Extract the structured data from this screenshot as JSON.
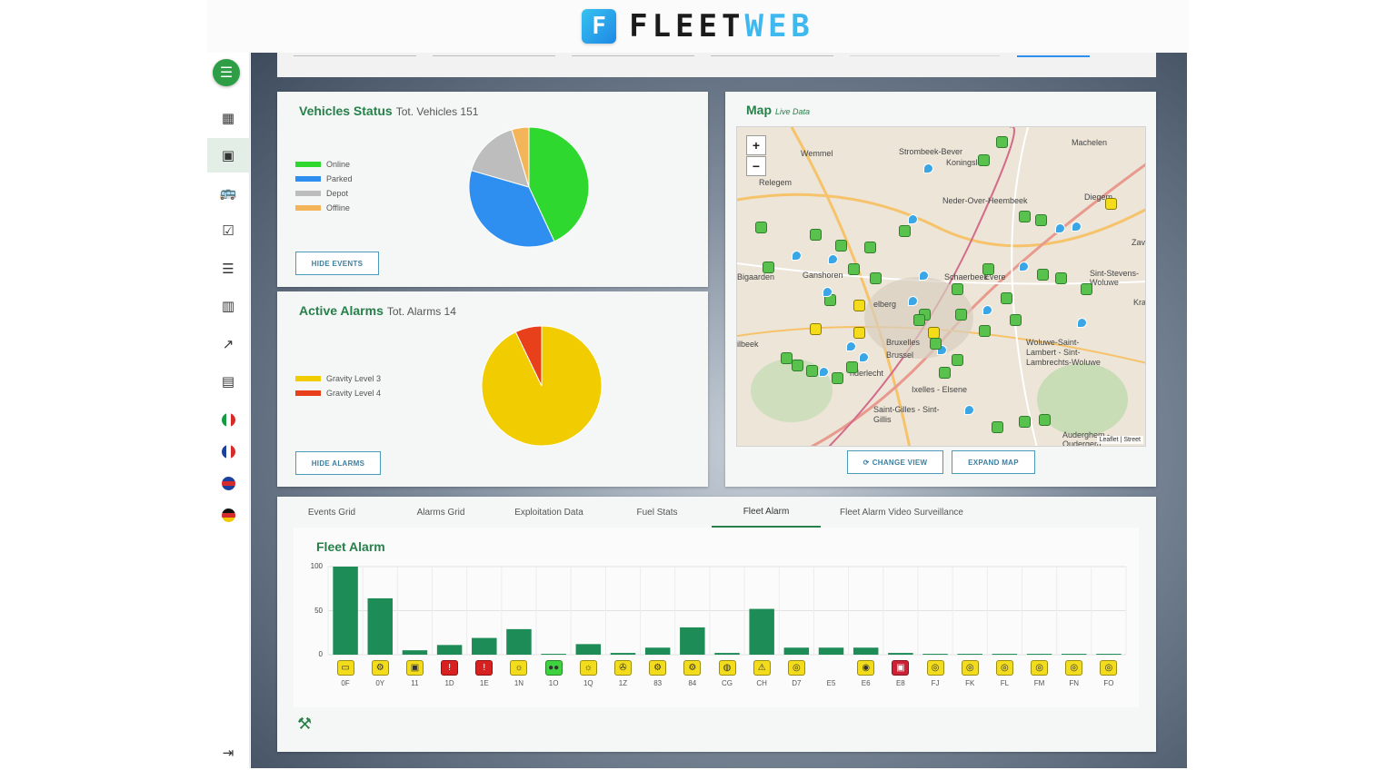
{
  "header": {
    "logo_fleet": "FLEET",
    "logo_web": "WEB",
    "logo_mark": "F"
  },
  "sidebar": {
    "items": [
      {
        "name": "sidebar-item-dashboard",
        "icon": "dashboard-icon",
        "glyph": "▦"
      },
      {
        "name": "sidebar-item-overview",
        "icon": "overview-dashboard-icon",
        "glyph": "▣",
        "active": true
      },
      {
        "name": "sidebar-item-vehicles",
        "icon": "bus-icon",
        "glyph": "🚌"
      },
      {
        "name": "sidebar-item-tasks",
        "icon": "checklist-icon",
        "glyph": "☑"
      },
      {
        "name": "sidebar-item-list",
        "icon": "list-icon",
        "glyph": "☰"
      },
      {
        "name": "sidebar-item-reports",
        "icon": "bar-report-icon",
        "glyph": "▥"
      },
      {
        "name": "sidebar-item-trends",
        "icon": "trend-line-icon",
        "glyph": "↗"
      },
      {
        "name": "sidebar-item-stats",
        "icon": "stats-icon",
        "glyph": "▤"
      }
    ],
    "languages": [
      "italian-flag-icon",
      "french-flag-icon",
      "uk-flag-icon",
      "german-flag-icon"
    ]
  },
  "vehicles_status": {
    "title": "Vehicles Status",
    "subtitle": "Tot. Vehicles 151",
    "button": "HIDE EVENTS",
    "legend": [
      "Online",
      "Parked",
      "Depot",
      "Offline"
    ],
    "colors": [
      "#2ed82e",
      "#2f8ff0",
      "#bdbdbd",
      "#f4b55a"
    ],
    "values": [
      65,
      55,
      24,
      7
    ]
  },
  "active_alarms": {
    "title": "Active Alarms",
    "subtitle": "Tot. Alarms 14",
    "button": "HIDE ALARMS",
    "legend": [
      "Gravity Level 3",
      "Gravity Level 4"
    ],
    "colors": [
      "#f0cc00",
      "#e8401a"
    ],
    "values": [
      13,
      1
    ]
  },
  "map": {
    "title": "Map",
    "subtitle": "Live Data",
    "zoom_in": "+",
    "zoom_out": "−",
    "attribution": "Leaflet | Street",
    "places": [
      "Wemmel",
      "Machelen",
      "Strombeek-Bever",
      "Koningslo",
      "Relegem",
      "Neder-Over-Heembeek",
      "Diegem",
      "Ganshoren",
      "Schaerbeek",
      "Sint-Stevens-Woluwe",
      "Zav",
      "Kraain",
      "Bruxelles",
      "Brussel",
      "Woluwe-Saint-Lambert - Sint-Lambrechts-Woluwe",
      "Bigaarden",
      "elberg",
      "ilbeek",
      "nderlecht",
      "Ixelles - Elsene",
      "Saint-Gilles - Sint-Gillis",
      "Auderghem - Oudergem",
      "Evere"
    ],
    "change_view": "CHANGE VIEW",
    "expand_map": "EXPAND MAP"
  },
  "tabs": [
    "Events Grid",
    "Alarms Grid",
    "Exploitation Data",
    "Fuel Stats",
    "Fleet Alarm",
    "Fleet Alarm Video Surveillance"
  ],
  "active_tab": "Fleet Alarm",
  "chart_data": {
    "type": "bar",
    "title": "Fleet Alarm",
    "categories": [
      "0F",
      "0Y",
      "11",
      "1D",
      "1E",
      "1N",
      "1O",
      "1Q",
      "1Z",
      "83",
      "84",
      "CG",
      "CH",
      "D7",
      "E5",
      "E6",
      "E8",
      "FJ",
      "FK",
      "FL",
      "FM",
      "FN",
      "FO"
    ],
    "values": [
      100,
      64,
      5,
      11,
      19,
      29,
      1,
      12,
      2,
      8,
      31,
      2,
      52,
      8,
      8,
      8,
      2,
      1,
      1,
      1,
      1,
      1,
      1
    ],
    "ylim": [
      0,
      100
    ],
    "yticks": [
      100,
      50,
      0
    ],
    "bar_color": "#1e8c56",
    "grid": true,
    "icon_colors": [
      "#f2dc1b",
      "#f2dc1b",
      "#f2dc1b",
      "#d92020",
      "#d92020",
      "#f2dc1b",
      "#3ed23e",
      "#f2dc1b",
      "#f2dc1b",
      "#f2dc1b",
      "#f2dc1b",
      "#f2dc1b",
      "#f2dc1b",
      "#f2dc1b",
      "",
      "#f2dc1b",
      "#cc2236",
      "#f2dc1b",
      "#f2dc1b",
      "#f2dc1b",
      "#f2dc1b",
      "#f2dc1b",
      "#f2dc1b"
    ],
    "icon_glyphs": [
      "▭",
      "⚙",
      "▣",
      "!",
      "!",
      "☼",
      "●●",
      "☼",
      "✇",
      "⚙",
      "⚙",
      "◍",
      "⚠",
      "◎",
      "",
      "◉",
      "▣",
      "◎",
      "◎",
      "◎",
      "◎",
      "◎",
      "◎"
    ]
  }
}
